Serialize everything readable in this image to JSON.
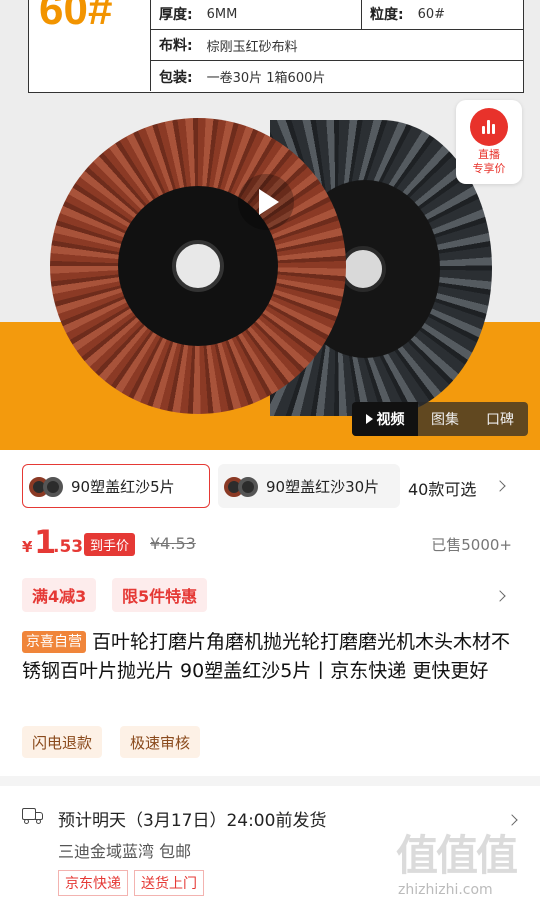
{
  "spec": {
    "grit_big": "60#",
    "thickness_label": "厚度:",
    "thickness_value": "6MM",
    "grit_label": "粒度:",
    "grit_value": "60#",
    "cloth_label": "布料:",
    "cloth_value": "棕刚玉红砂布料",
    "pack_label": "包装:",
    "pack_value": "一卷30片    1箱600片"
  },
  "live": {
    "line1": "直播",
    "line2": "专享价"
  },
  "media_tabs": [
    "视频",
    "图集",
    "口碑"
  ],
  "variants": {
    "items": [
      {
        "label": "90塑盖红沙5片",
        "selected": true
      },
      {
        "label": "90塑盖红沙30片",
        "selected": false
      }
    ],
    "count_text": "40款可选"
  },
  "price": {
    "currency": "¥",
    "integer": "1",
    "decimal": ".53",
    "hand_price_label": "到手价",
    "original": "¥4.53",
    "sold": "已售5000+"
  },
  "promos": [
    "满4减3",
    "限5件特惠"
  ],
  "title": {
    "tag": "京喜自营",
    "text": "百叶轮打磨片角磨机抛光轮打磨磨光机木头木材不锈钢百叶片抛光片 90塑盖红沙5片丨京东快递 更快更好"
  },
  "services": [
    "闪电退款",
    "极速审核"
  ],
  "delivery": {
    "eta": "预计明天（3月17日）24:00前发货",
    "address": "三迪金域蓝湾  包邮",
    "tags": [
      "京东快递",
      "送货上门"
    ]
  },
  "watermark": {
    "logo": "值值值",
    "site": "zhizhizhi.com"
  },
  "colors": {
    "accent_red": "#e53935",
    "orange_band": "#f39a0d",
    "grit_orange": "#f29400"
  }
}
